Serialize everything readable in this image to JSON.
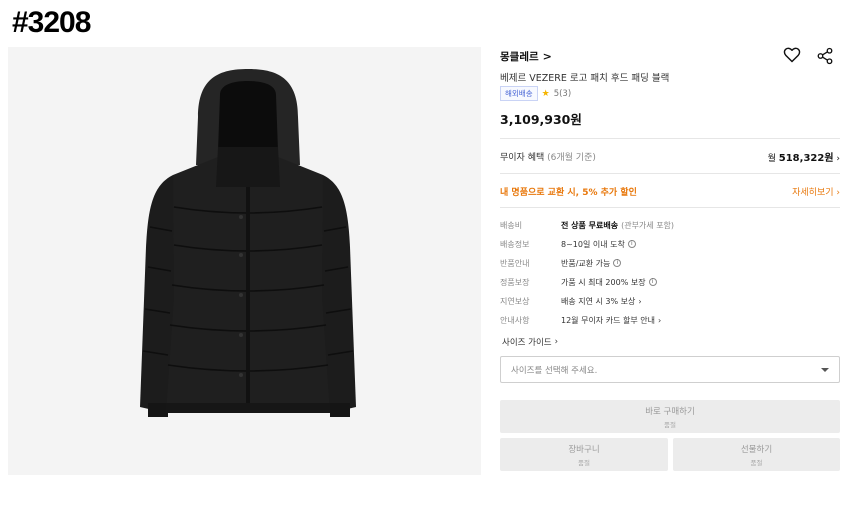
{
  "tag": "#3208",
  "product": {
    "brand": "몽클레르",
    "brand_chevron": ">",
    "title": "베제르 VEZERE 로고 패치 후드 패딩 블랙",
    "badge": "해외배송",
    "rating": "5(3)",
    "price": "3,109,930원"
  },
  "benefit": {
    "label": "무이자 혜택",
    "period": "(6개월 기준)",
    "prefix": "월",
    "amount": "518,322원"
  },
  "promo": {
    "text": "내 명품으로 교환 시, 5% 추가 할인",
    "link": "자세히보기"
  },
  "specs": [
    {
      "key": "배송비",
      "value": "전 상품 무료배송",
      "note": "(관부가세 포함)"
    },
    {
      "key": "배송정보",
      "value": "8~10일 이내 도착"
    },
    {
      "key": "반품안내",
      "value": "반품/교환 가능"
    },
    {
      "key": "정품보장",
      "value": "가품 시 최대 200% 보장"
    },
    {
      "key": "지연보상",
      "value": "배송 지연 시 3% 보상"
    },
    {
      "key": "안내사항",
      "value": "12월 무이자 카드 할부 안내"
    }
  ],
  "size_guide": "사이즈 가이드",
  "size_select": {
    "placeholder": "사이즈를 선택해 주세요."
  },
  "buttons": {
    "buy": {
      "label": "바로 구매하기",
      "sub": "품절"
    },
    "cart": {
      "label": "장바구니",
      "sub": "품절"
    },
    "gift": {
      "label": "선물하기",
      "sub": "품절"
    }
  },
  "colors": {
    "accent": "#e8780c",
    "badge": "#4a67d6",
    "star": "#f5b400",
    "disabled": "#ececec"
  },
  "icons": [
    "heart-icon",
    "share-icon",
    "star-icon",
    "info-icon",
    "chevron-right-icon",
    "caret-down-icon"
  ]
}
